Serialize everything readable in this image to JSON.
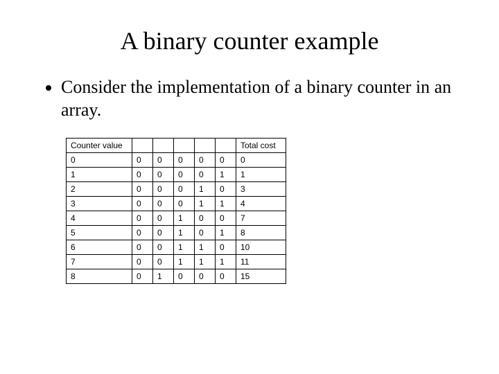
{
  "title": "A binary counter example",
  "bullet": "Consider the implementation of a binary counter in an array.",
  "table": {
    "header_counter": "Counter value",
    "header_cost": "Total cost",
    "rows": [
      {
        "counter": "0",
        "bits": [
          "0",
          "0",
          "0",
          "0",
          "0"
        ],
        "cost": "0"
      },
      {
        "counter": "1",
        "bits": [
          "0",
          "0",
          "0",
          "0",
          "1"
        ],
        "cost": "1"
      },
      {
        "counter": "2",
        "bits": [
          "0",
          "0",
          "0",
          "1",
          "0"
        ],
        "cost": "3"
      },
      {
        "counter": "3",
        "bits": [
          "0",
          "0",
          "0",
          "1",
          "1"
        ],
        "cost": "4"
      },
      {
        "counter": "4",
        "bits": [
          "0",
          "0",
          "1",
          "0",
          "0"
        ],
        "cost": "7"
      },
      {
        "counter": "5",
        "bits": [
          "0",
          "0",
          "1",
          "0",
          "1"
        ],
        "cost": "8"
      },
      {
        "counter": "6",
        "bits": [
          "0",
          "0",
          "1",
          "1",
          "0"
        ],
        "cost": "10"
      },
      {
        "counter": "7",
        "bits": [
          "0",
          "0",
          "1",
          "1",
          "1"
        ],
        "cost": "11"
      },
      {
        "counter": "8",
        "bits": [
          "0",
          "1",
          "0",
          "0",
          "0"
        ],
        "cost": "15"
      }
    ]
  }
}
